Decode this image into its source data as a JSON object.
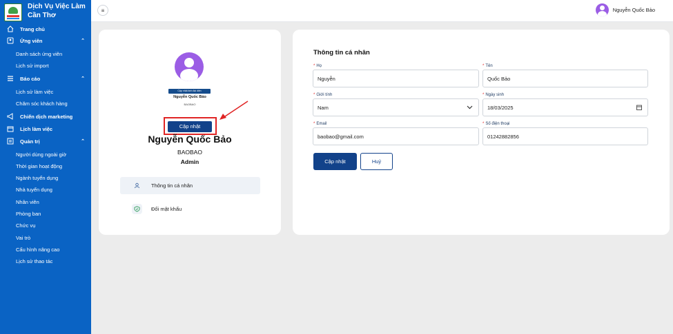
{
  "brand": {
    "line1": "Dịch Vụ Việc Làm",
    "line2": "Cần Thơ"
  },
  "colors": {
    "sidebar": "#0a63c4",
    "primary": "#12428a",
    "avatar": "#9b5de5",
    "highlight": "#e02424"
  },
  "sidebar": {
    "items": [
      {
        "label": "Trang chủ",
        "icon": "home-icon"
      },
      {
        "label": "Ứng viên",
        "icon": "user-icon"
      },
      {
        "label": "Danh sách ứng viên"
      },
      {
        "label": "Lịch sử import"
      },
      {
        "label": "Báo cáo",
        "icon": "list-icon"
      },
      {
        "label": "Lịch sử làm việc"
      },
      {
        "label": "Chăm sóc khách hàng"
      },
      {
        "label": "Chiến dịch marketing",
        "icon": "megaphone-icon"
      },
      {
        "label": "Lịch làm việc",
        "icon": "calendar-icon"
      },
      {
        "label": "Quản trị",
        "icon": "admin-icon"
      },
      {
        "label": "Người dùng ngoài giờ"
      },
      {
        "label": "Thời gian hoạt động"
      },
      {
        "label": "Ngành tuyển dụng"
      },
      {
        "label": "Nhà tuyển dụng"
      },
      {
        "label": "Nhân viên"
      },
      {
        "label": "Phòng ban"
      },
      {
        "label": "Chức vụ"
      },
      {
        "label": "Vai trò"
      },
      {
        "label": "Cấu hình nâng cao"
      },
      {
        "label": "Lịch sử thao tác"
      }
    ]
  },
  "topbar": {
    "user_name": "Nguyễn Quốc Bảo"
  },
  "profile": {
    "mini_button": "Cập nhật ảnh đại diện",
    "mini_name": "Nguyễn Quốc Bảo",
    "mini_username": "BAOBAO",
    "update_button": "Cập nhật",
    "full_name": "Nguyễn Quốc Bảo",
    "username": "BAOBAO",
    "role": "Admin",
    "menu": [
      {
        "label": "Thông tin cá nhân",
        "icon": "user-icon"
      },
      {
        "label": "Đổi mật khẩu",
        "icon": "shield-icon"
      }
    ]
  },
  "form": {
    "title": "Thông tin cá nhân",
    "last_name": {
      "label": "Họ",
      "value": "Nguyễn"
    },
    "first_name": {
      "label": "Tên",
      "value": "Quốc Bảo"
    },
    "gender": {
      "label": "Giới tính",
      "value": "Nam"
    },
    "dob": {
      "label": "Ngày sinh",
      "value": "18/03/2025"
    },
    "email": {
      "label": "Email",
      "value": "baobao@gmail.com"
    },
    "phone": {
      "label": "Số điện thoại",
      "value": "01242882856"
    },
    "submit": "Cập nhật",
    "cancel": "Huỷ"
  }
}
